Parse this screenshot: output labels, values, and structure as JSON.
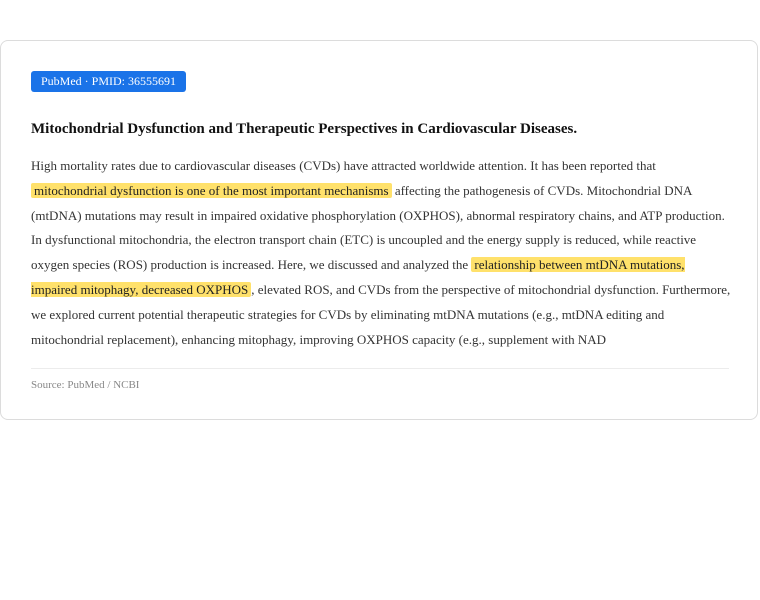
{
  "badge": "PubMed · PMID: 36555691",
  "title": "Mitochondrial Dysfunction and Therapeutic Perspectives in Cardiovascular Diseases.",
  "abstract": {
    "seg1": "High mortality rates due to cardiovascular diseases (CVDs) have attracted worldwide attention. It has been reported that ",
    "hl1": "mitochondrial dysfunction is one of the most important mechanisms",
    "seg2": " affecting the pathogenesis of CVDs. Mitochondrial DNA (mtDNA) mutations may result in impaired oxidative phosphorylation (OXPHOS), abnormal respiratory chains, and ATP production. In dysfunctional mitochondria, the electron transport chain (ETC) is uncoupled and the energy supply is reduced, while reactive oxygen species (ROS) production is increased. Here, we discussed and analyzed the ",
    "hl2": "relationship between mtDNA mutations, impaired mitophagy, decreased OXPHOS",
    "seg3": ", elevated ROS, and CVDs from the perspective of mitochondrial dysfunction. Furthermore, we explored current potential therapeutic strategies for CVDs by eliminating mtDNA mutations (e.g., mtDNA editing and mitochondrial replacement), enhancing mitophagy, improving OXPHOS capacity (e.g., supplement with NAD"
  },
  "source": "Source: PubMed / NCBI",
  "colors": {
    "badge_bg": "#1a73e8",
    "highlight": "#ffe16b"
  }
}
